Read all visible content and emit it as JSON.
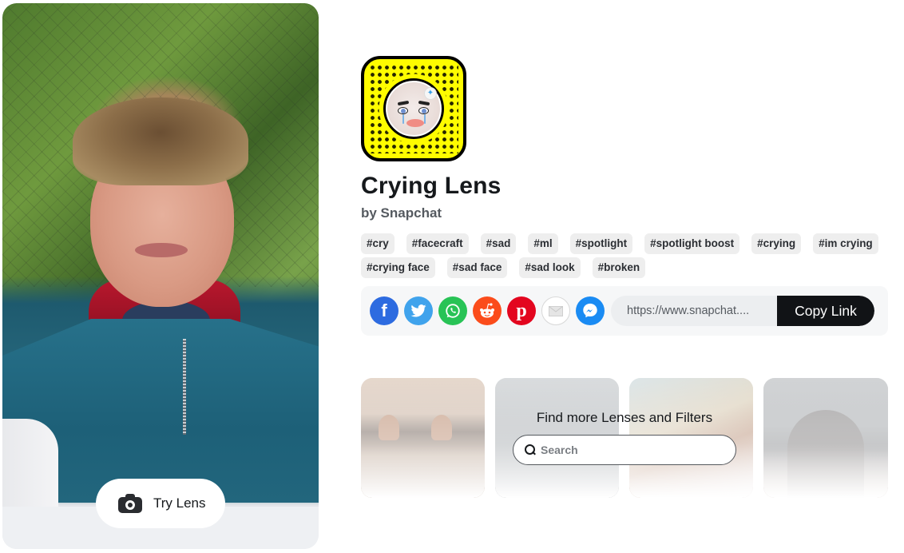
{
  "preview": {
    "try_lens_label": "Try Lens",
    "camera_icon": "camera-icon"
  },
  "lens": {
    "name": "Crying Lens",
    "author": "by Snapchat",
    "snapcode_color": "#fffc00",
    "tags": [
      "#cry",
      "#facecraft",
      "#sad",
      "#ml",
      "#spotlight",
      "#spotlight boost",
      "#crying",
      "#im crying",
      "#crying face",
      "#sad face",
      "#sad look",
      "#broken"
    ]
  },
  "share": {
    "networks": [
      {
        "name": "facebook",
        "icon": "facebook-icon",
        "color": "#2d6be0"
      },
      {
        "name": "twitter",
        "icon": "twitter-icon",
        "color": "#40a3ec"
      },
      {
        "name": "whatsapp",
        "icon": "whatsapp-icon",
        "color": "#28c356"
      },
      {
        "name": "reddit",
        "icon": "reddit-icon",
        "color": "#fb4c1b"
      },
      {
        "name": "pinterest",
        "icon": "pinterest-icon",
        "color": "#e3061f"
      },
      {
        "name": "email",
        "icon": "mail-icon",
        "color": "#ffffff"
      },
      {
        "name": "messenger",
        "icon": "messenger-icon",
        "color": "#1a8bf3"
      }
    ],
    "link_url": "https://www.snapchat....",
    "copy_label": "Copy Link"
  },
  "more": {
    "title": "Find more Lenses and Filters",
    "search_placeholder": "Search"
  }
}
